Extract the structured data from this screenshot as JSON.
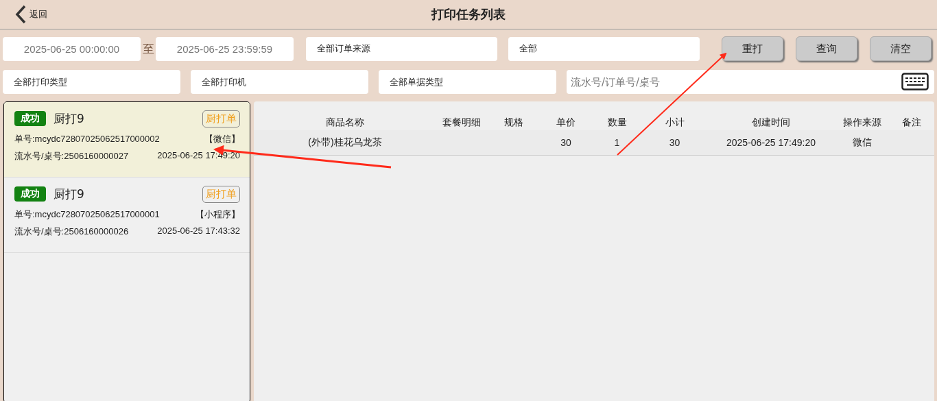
{
  "header": {
    "back": "返回",
    "title": "打印任务列表"
  },
  "filters": {
    "start_time": "2025-06-25 00:00:00",
    "separator": "至",
    "end_time": "2025-06-25 23:59:59",
    "order_source": "全部订单来源",
    "status": "全部",
    "print_type": "全部打印类型",
    "printer": "全部打印机",
    "document_type": "全部单据类型",
    "search": {
      "placeholder": "流水号/订单号/桌号"
    }
  },
  "buttons": [
    "重打",
    "查询",
    "清空"
  ],
  "tasks": [
    {
      "status": "成功",
      "name": "厨打9",
      "tag": "厨打单",
      "order_no": "单号:mcydc72807025062517000002",
      "source": "【微信】",
      "serial": "流水号/桌号:2506160000027",
      "time": "2025-06-25 17:49:20",
      "selected": true
    },
    {
      "status": "成功",
      "name": "厨打9",
      "tag": "厨打单",
      "order_no": "单号:mcydc72807025062517000001",
      "source": "【小程序】",
      "serial": "流水号/桌号:2506160000026",
      "time": "2025-06-25 17:43:32",
      "selected": false
    }
  ],
  "table": {
    "columns": [
      "商品名称",
      "套餐明细",
      "规格",
      "单价",
      "数量",
      "小计",
      "创建时间",
      "操作来源",
      "备注"
    ],
    "rows": [
      [
        "(外带)桂花乌龙茶",
        "",
        "",
        "30",
        "1",
        "30",
        "2025-06-25 17:49:20",
        "微信",
        ""
      ]
    ]
  }
}
